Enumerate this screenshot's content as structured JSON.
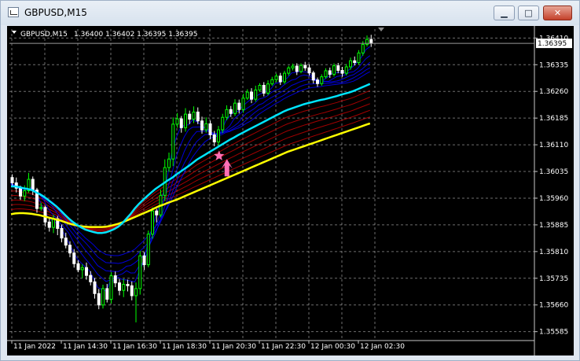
{
  "window": {
    "title": "GBPUSD,M15",
    "buttons": {
      "minimize": "▁",
      "maximize": "□",
      "close": "✕"
    }
  },
  "header": {
    "symbol_timeframe": "GBPUSD,M15",
    "ohlc": "1.36400 1.36402 1.36395 1.36395"
  },
  "price_axis": {
    "labels": [
      "1.36410",
      "1.36335",
      "1.36260",
      "1.36185",
      "1.36110",
      "1.36035",
      "1.35960",
      "1.35885",
      "1.35810",
      "1.35735",
      "1.35660",
      "1.35585"
    ],
    "current_price": "1.36395"
  },
  "time_axis": {
    "labels": [
      "11 Jan 2022",
      "11 Jan 14:30",
      "11 Jan 16:30",
      "11 Jan 18:30",
      "11 Jan 20:30",
      "11 Jan 22:30",
      "12 Jan 00:30",
      "12 Jan 02:30"
    ]
  },
  "colors": {
    "background": "#000000",
    "grid": "#c8c8c8",
    "bull": "#00ff00",
    "bear": "#ffffff",
    "fast_ma": "#00e5ff",
    "slow_ma": "#ffff00",
    "blue_ribbon": "#0000ff",
    "red_ribbon": "#b40000",
    "signal": "#ff6fb5",
    "axis_text": "#ffffff"
  },
  "signal": {
    "star_icon": "star-icon",
    "arrow_icon": "up-arrow-icon"
  },
  "chart_data": {
    "type": "candlestick",
    "symbol": "GBPUSD",
    "timeframe": "M15",
    "ylim": [
      1.3556,
      1.36435
    ],
    "candles": [
      [
        1.36018,
        1.36027,
        1.35994,
        1.36003
      ],
      [
        1.36003,
        1.36018,
        1.35976,
        1.35988
      ],
      [
        1.35988,
        1.35995,
        1.35955,
        1.35966
      ],
      [
        1.35966,
        1.35996,
        1.35952,
        1.35981
      ],
      [
        1.35981,
        1.36031,
        1.35975,
        1.36013
      ],
      [
        1.36013,
        1.36021,
        1.35969,
        1.35983
      ],
      [
        1.35983,
        1.35989,
        1.35919,
        1.35931
      ],
      [
        1.35931,
        1.35947,
        1.35925,
        1.35934
      ],
      [
        1.35934,
        1.35939,
        1.3588,
        1.35893
      ],
      [
        1.35893,
        1.35907,
        1.35866,
        1.35878
      ],
      [
        1.35878,
        1.35913,
        1.35862,
        1.35902
      ],
      [
        1.35902,
        1.3591,
        1.35856,
        1.35875
      ],
      [
        1.35875,
        1.35886,
        1.35836,
        1.35848
      ],
      [
        1.35848,
        1.35863,
        1.35819,
        1.35828
      ],
      [
        1.35828,
        1.35839,
        1.35794,
        1.35806
      ],
      [
        1.35806,
        1.35817,
        1.35765,
        1.35776
      ],
      [
        1.35776,
        1.35785,
        1.35752,
        1.35759
      ],
      [
        1.35759,
        1.35774,
        1.35735,
        1.35765
      ],
      [
        1.35765,
        1.35779,
        1.35731,
        1.35743
      ],
      [
        1.35743,
        1.35755,
        1.35715,
        1.35725
      ],
      [
        1.35725,
        1.35736,
        1.35678,
        1.35692
      ],
      [
        1.35692,
        1.35705,
        1.35648,
        1.3566
      ],
      [
        1.3566,
        1.35717,
        1.3565,
        1.35706
      ],
      [
        1.35706,
        1.35719,
        1.35667,
        1.35676
      ],
      [
        1.35676,
        1.35752,
        1.35664,
        1.35742
      ],
      [
        1.35742,
        1.35754,
        1.3571,
        1.35722
      ],
      [
        1.35722,
        1.35733,
        1.35687,
        1.35701
      ],
      [
        1.35701,
        1.35733,
        1.35682,
        1.35718
      ],
      [
        1.35718,
        1.35731,
        1.35698,
        1.35714
      ],
      [
        1.35714,
        1.35726,
        1.35673,
        1.35686
      ],
      [
        1.35686,
        1.35723,
        1.35611,
        1.35706
      ],
      [
        1.35706,
        1.35812,
        1.35689,
        1.35798
      ],
      [
        1.35798,
        1.35808,
        1.35758,
        1.35773
      ],
      [
        1.35773,
        1.35869,
        1.35766,
        1.35859
      ],
      [
        1.35859,
        1.35934,
        1.35846,
        1.35924
      ],
      [
        1.35924,
        1.3593,
        1.35892,
        1.35913
      ],
      [
        1.35913,
        1.35984,
        1.35906,
        1.35968
      ],
      [
        1.35968,
        1.36069,
        1.35952,
        1.36046
      ],
      [
        1.36046,
        1.36088,
        1.36034,
        1.3607
      ],
      [
        1.3607,
        1.36187,
        1.3605,
        1.36168
      ],
      [
        1.36168,
        1.36199,
        1.36158,
        1.36183
      ],
      [
        1.36183,
        1.36191,
        1.36144,
        1.36158
      ],
      [
        1.36158,
        1.36213,
        1.36147,
        1.36196
      ],
      [
        1.36196,
        1.36206,
        1.36168,
        1.36182
      ],
      [
        1.36182,
        1.36218,
        1.36171,
        1.36202
      ],
      [
        1.36202,
        1.36215,
        1.36168,
        1.36177
      ],
      [
        1.36177,
        1.36189,
        1.36141,
        1.36152
      ],
      [
        1.36152,
        1.36187,
        1.36144,
        1.36169
      ],
      [
        1.36169,
        1.36178,
        1.36126,
        1.36138
      ],
      [
        1.36138,
        1.36149,
        1.36106,
        1.36118
      ],
      [
        1.36118,
        1.36163,
        1.36107,
        1.36152
      ],
      [
        1.36152,
        1.36197,
        1.36143,
        1.36187
      ],
      [
        1.36187,
        1.36221,
        1.36179,
        1.36209
      ],
      [
        1.36209,
        1.36219,
        1.36188,
        1.36198
      ],
      [
        1.36198,
        1.36238,
        1.36191,
        1.36227
      ],
      [
        1.36227,
        1.36237,
        1.36198,
        1.36209
      ],
      [
        1.36209,
        1.36253,
        1.362,
        1.36241
      ],
      [
        1.36241,
        1.36266,
        1.36236,
        1.36258
      ],
      [
        1.36258,
        1.36269,
        1.36227,
        1.36238
      ],
      [
        1.36238,
        1.36276,
        1.36231,
        1.36264
      ],
      [
        1.36264,
        1.36283,
        1.36259,
        1.36277
      ],
      [
        1.36277,
        1.36286,
        1.36246,
        1.36255
      ],
      [
        1.36255,
        1.36291,
        1.36249,
        1.36281
      ],
      [
        1.36281,
        1.36301,
        1.36276,
        1.36293
      ],
      [
        1.36293,
        1.3631,
        1.36286,
        1.36303
      ],
      [
        1.36303,
        1.36312,
        1.36278,
        1.36287
      ],
      [
        1.36287,
        1.36318,
        1.36281,
        1.36311
      ],
      [
        1.36311,
        1.36332,
        1.36304,
        1.36326
      ],
      [
        1.36326,
        1.36338,
        1.36319,
        1.36331
      ],
      [
        1.36331,
        1.36339,
        1.36306,
        1.36316
      ],
      [
        1.36316,
        1.36339,
        1.36311,
        1.36333
      ],
      [
        1.36333,
        1.36343,
        1.36318,
        1.36326
      ],
      [
        1.36326,
        1.36336,
        1.36304,
        1.36312
      ],
      [
        1.36312,
        1.36318,
        1.36282,
        1.36292
      ],
      [
        1.36292,
        1.36299,
        1.36273,
        1.36282
      ],
      [
        1.36282,
        1.36308,
        1.36276,
        1.36301
      ],
      [
        1.36301,
        1.36325,
        1.36296,
        1.36318
      ],
      [
        1.36318,
        1.36327,
        1.36298,
        1.36308
      ],
      [
        1.36308,
        1.36339,
        1.36302,
        1.36332
      ],
      [
        1.36332,
        1.3634,
        1.36311,
        1.36319
      ],
      [
        1.36319,
        1.36329,
        1.36301,
        1.36311
      ],
      [
        1.36311,
        1.36337,
        1.36305,
        1.36329
      ],
      [
        1.36329,
        1.36355,
        1.36321,
        1.36346
      ],
      [
        1.36346,
        1.36358,
        1.36333,
        1.36341
      ],
      [
        1.36341,
        1.36376,
        1.36335,
        1.36368
      ],
      [
        1.36368,
        1.36401,
        1.3636,
        1.36392
      ],
      [
        1.36392,
        1.36417,
        1.36386,
        1.36406
      ],
      [
        1.36406,
        1.36419,
        1.36385,
        1.36395
      ]
    ],
    "fast_ma": [
      1.35993,
      1.35993,
      1.35991,
      1.35988,
      1.35986,
      1.35983,
      1.35977,
      1.35971,
      1.35964,
      1.35955,
      1.35946,
      1.35937,
      1.35926,
      1.35914,
      1.35903,
      1.35893,
      1.35885,
      1.35878,
      1.35872,
      1.35868,
      1.35865,
      1.35862,
      1.35862,
      1.35864,
      1.35868,
      1.35873,
      1.3588,
      1.3589,
      1.35903,
      1.35916,
      1.35931,
      1.35944,
      1.35955,
      1.35966,
      1.35976,
      1.35986,
      1.35994,
      1.36002,
      1.3601,
      1.36017,
      1.36026,
      1.36034,
      1.36042,
      1.3605,
      1.36059,
      1.36068,
      1.36075,
      1.36082,
      1.36089,
      1.36096,
      1.36103,
      1.3611,
      1.36117,
      1.36124,
      1.3613,
      1.36137,
      1.36143,
      1.36149,
      1.36155,
      1.36161,
      1.36167,
      1.36173,
      1.36179,
      1.36185,
      1.36191,
      1.36197,
      1.36203,
      1.36208,
      1.36212,
      1.36216,
      1.3622,
      1.36224,
      1.36227,
      1.3623,
      1.36233,
      1.36236,
      1.36238,
      1.36241,
      1.36244,
      1.36247,
      1.36251,
      1.36254,
      1.36257,
      1.36261,
      1.36266,
      1.36271,
      1.36276,
      1.36281
    ],
    "slow_ma": [
      1.35915,
      1.35917,
      1.35918,
      1.35918,
      1.35917,
      1.35916,
      1.35914,
      1.35912,
      1.35909,
      1.35906,
      1.35903,
      1.359,
      1.35897,
      1.35893,
      1.35889,
      1.35886,
      1.35883,
      1.35881,
      1.3588,
      1.35879,
      1.35879,
      1.35879,
      1.35879,
      1.3588,
      1.35882,
      1.35885,
      1.35888,
      1.35892,
      1.35897,
      1.35902,
      1.35907,
      1.35912,
      1.35917,
      1.35922,
      1.35927,
      1.35933,
      1.35938,
      1.35942,
      1.35947,
      1.35951,
      1.35955,
      1.3596,
      1.35965,
      1.3597,
      1.35975,
      1.3598,
      1.35985,
      1.3599,
      1.35995,
      1.36,
      1.36005,
      1.3601,
      1.36015,
      1.3602,
      1.36025,
      1.3603,
      1.36035,
      1.3604,
      1.36045,
      1.3605,
      1.36055,
      1.3606,
      1.36065,
      1.3607,
      1.36075,
      1.3608,
      1.36085,
      1.3609,
      1.36094,
      1.36098,
      1.36102,
      1.36106,
      1.3611,
      1.36114,
      1.36118,
      1.36122,
      1.36126,
      1.3613,
      1.36134,
      1.36138,
      1.36142,
      1.36146,
      1.3615,
      1.36154,
      1.36158,
      1.36162,
      1.36166,
      1.3617
    ],
    "signals": [
      {
        "type": "buy",
        "index": 51,
        "price": 1.3607
      }
    ]
  }
}
